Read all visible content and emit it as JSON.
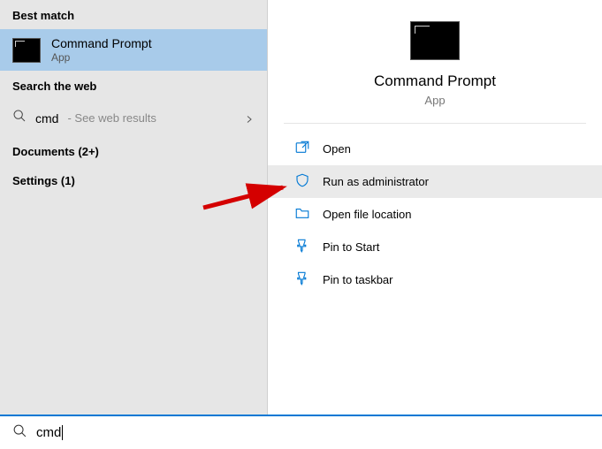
{
  "left": {
    "best_match_header": "Best match",
    "result": {
      "title": "Command Prompt",
      "subtitle": "App"
    },
    "search_web_header": "Search the web",
    "web": {
      "query": "cmd",
      "hint": "- See web results"
    },
    "documents_header": "Documents (2+)",
    "settings_header": "Settings (1)"
  },
  "preview": {
    "title": "Command Prompt",
    "subtitle": "App"
  },
  "actions": {
    "open": "Open",
    "run_admin": "Run as administrator",
    "open_location": "Open file location",
    "pin_start": "Pin to Start",
    "pin_taskbar": "Pin to taskbar"
  },
  "search": {
    "value": "cmd"
  }
}
